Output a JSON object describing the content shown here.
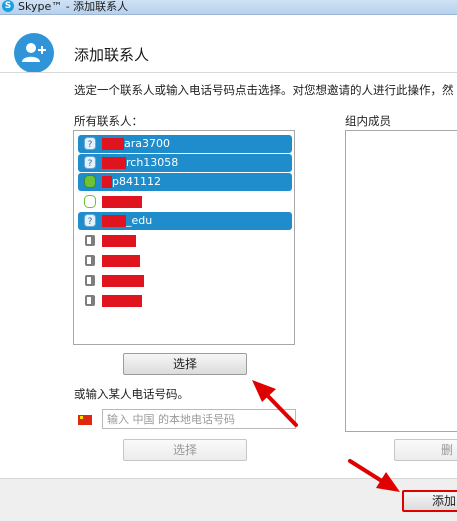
{
  "window": {
    "app_icon": "S",
    "title": "Skype™ - 添加联系人"
  },
  "header": {
    "title": "添加联系人",
    "icon": "add-contact-icon"
  },
  "instruction": "选定一个联系人或输入电话号码点击选择。对您想邀请的人进行此操作，然",
  "contacts": {
    "label": "所有联系人：",
    "items": [
      {
        "name": "ara3700",
        "selected": true,
        "status": "skype-question-icon"
      },
      {
        "name": "rch13058",
        "selected": true,
        "status": "skype-question-icon"
      },
      {
        "name": "p841112",
        "selected": true,
        "status": "skype-online-icon"
      },
      {
        "name": "",
        "selected": false,
        "status": "skype-online-icon"
      },
      {
        "name": "_edu",
        "selected": true,
        "status": "skype-question-icon"
      },
      {
        "name": "",
        "selected": false,
        "status": "phone-contact-icon"
      },
      {
        "name": "",
        "selected": false,
        "status": "phone-contact-icon"
      },
      {
        "name": "",
        "selected": false,
        "status": "phone-contact-icon"
      },
      {
        "name": "",
        "selected": false,
        "status": "phone-contact-icon"
      }
    ],
    "select_button": "选择"
  },
  "phone": {
    "label": "或输入某人电话号码。",
    "placeholder": "输入 中国 的本地电话号码",
    "select_button": "选择",
    "flag": "china-flag-icon"
  },
  "group": {
    "label": "组内成员",
    "remove_button": "删"
  },
  "footer": {
    "add_button": "添加"
  },
  "colors": {
    "selection": "#1f8ccb",
    "accent": "#2f95d8",
    "annotation": "#e00000"
  }
}
